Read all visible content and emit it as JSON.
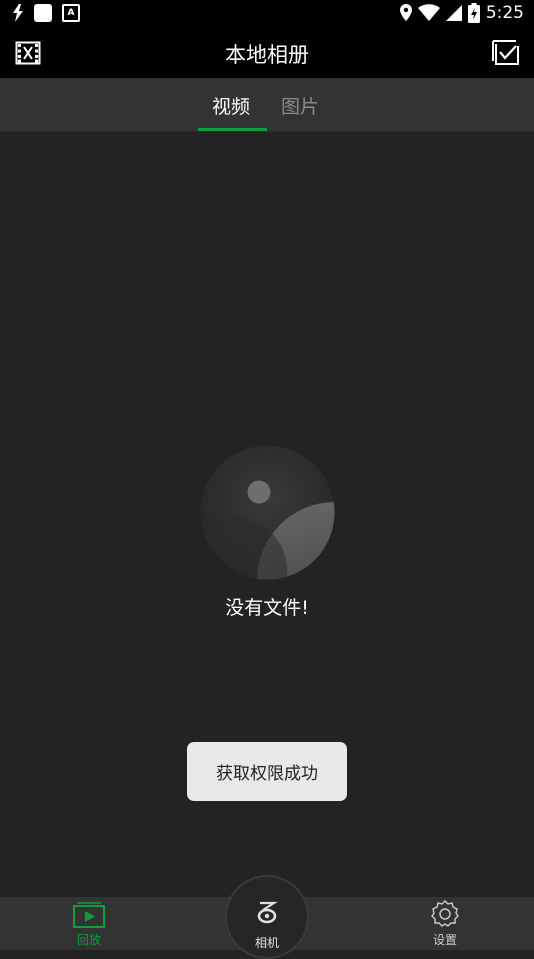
{
  "status_bar": {
    "time": "5:25",
    "icons": [
      "flash-icon",
      "app-square-icon",
      "a-badge-icon",
      "location-icon",
      "wifi-icon",
      "signal-icon",
      "battery-icon"
    ]
  },
  "app_bar": {
    "title": "本地相册",
    "left_icon": "film-icon",
    "right_icon": "checkbox-icon"
  },
  "tabs": [
    {
      "label": "视频",
      "active": true
    },
    {
      "label": "图片",
      "active": false
    }
  ],
  "empty_state": {
    "icon": "empty-media-icon",
    "text": "没有文件!"
  },
  "toast": {
    "text": "获取权限成功"
  },
  "bottom_nav": [
    {
      "label": "回放",
      "icon": "playback-icon",
      "active": true
    },
    {
      "label": "相机",
      "icon": "camera-brand-icon",
      "active": false
    },
    {
      "label": "设置",
      "icon": "settings-gear-icon",
      "active": false
    }
  ],
  "colors": {
    "accent": "#0f9d3f",
    "background": "#232323",
    "bar": "#333333",
    "toast_bg": "#e9e9e9"
  }
}
